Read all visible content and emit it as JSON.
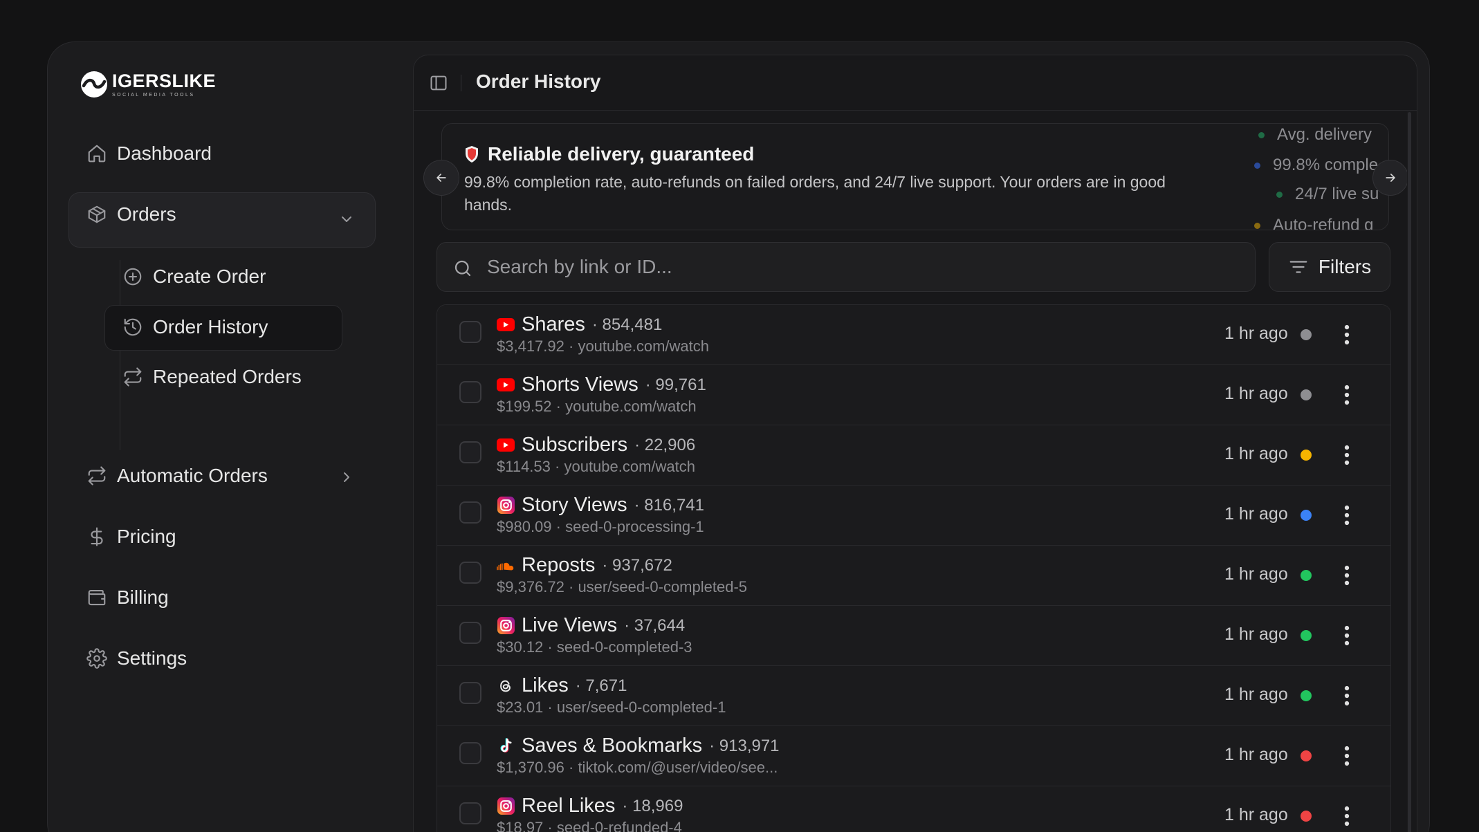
{
  "brand": {
    "name": "IGERSLIKE",
    "tagline": "SOCIAL MEDIA TOOLS"
  },
  "nav": {
    "dashboard": "Dashboard",
    "orders": "Orders",
    "orders_sub": {
      "create": "Create Order",
      "history": "Order History",
      "repeated": "Repeated Orders"
    },
    "automatic": "Automatic Orders",
    "pricing": "Pricing",
    "billing": "Billing",
    "settings": "Settings"
  },
  "header": {
    "title": "Order History"
  },
  "banner": {
    "title": "Reliable delivery, guaranteed",
    "text": "99.8% completion rate, auto-refunds on failed orders, and 24/7 live support. Your orders are in good hands.",
    "stats": [
      "Avg. delivery",
      "99.8% comple",
      "24/7 live su",
      "Auto-refund g"
    ]
  },
  "search": {
    "placeholder": "Search by link or ID...",
    "value": ""
  },
  "filters_label": "Filters",
  "colors": {
    "gray": "#8e8e92",
    "yellow": "#f5b400",
    "blue": "#3b82f6",
    "green": "#22c55e",
    "red": "#ef4444"
  },
  "orders": [
    {
      "platform": "youtube",
      "platform_icon": "youtube-icon",
      "service": "Shares",
      "qty": "854,481",
      "price": "$3,417.92",
      "link": "youtube.com/watch",
      "time": "1 hr ago",
      "status_color": "gray"
    },
    {
      "platform": "youtube",
      "platform_icon": "youtube-icon",
      "service": "Shorts Views",
      "qty": "99,761",
      "price": "$199.52",
      "link": "youtube.com/watch",
      "time": "1 hr ago",
      "status_color": "gray"
    },
    {
      "platform": "youtube",
      "platform_icon": "youtube-icon",
      "service": "Subscribers",
      "qty": "22,906",
      "price": "$114.53",
      "link": "youtube.com/watch",
      "time": "1 hr ago",
      "status_color": "yellow"
    },
    {
      "platform": "instagram",
      "platform_icon": "instagram-icon",
      "service": "Story Views",
      "qty": "816,741",
      "price": "$980.09",
      "link": "seed-0-processing-1",
      "time": "1 hr ago",
      "status_color": "blue"
    },
    {
      "platform": "soundcloud",
      "platform_icon": "soundcloud-icon",
      "service": "Reposts",
      "qty": "937,672",
      "price": "$9,376.72",
      "link": "user/seed-0-completed-5",
      "time": "1 hr ago",
      "status_color": "green"
    },
    {
      "platform": "instagram",
      "platform_icon": "instagram-icon",
      "service": "Live Views",
      "qty": "37,644",
      "price": "$30.12",
      "link": "seed-0-completed-3",
      "time": "1 hr ago",
      "status_color": "green"
    },
    {
      "platform": "threads",
      "platform_icon": "threads-icon",
      "service": "Likes",
      "qty": "7,671",
      "price": "$23.01",
      "link": "user/seed-0-completed-1",
      "time": "1 hr ago",
      "status_color": "green"
    },
    {
      "platform": "tiktok",
      "platform_icon": "tiktok-icon",
      "service": "Saves & Bookmarks",
      "qty": "913,971",
      "price": "$1,370.96",
      "link": "tiktok.com/@user/video/see...",
      "time": "1 hr ago",
      "status_color": "red"
    },
    {
      "platform": "instagram",
      "platform_icon": "instagram-icon",
      "service": "Reel Likes",
      "qty": "18,969",
      "price": "$18.97",
      "link": "seed-0-refunded-4",
      "time": "1 hr ago",
      "status_color": "red"
    }
  ]
}
